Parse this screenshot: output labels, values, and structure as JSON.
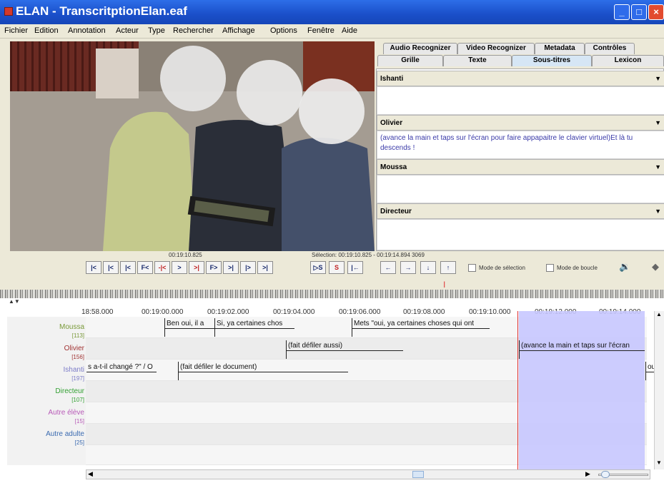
{
  "window": {
    "title": "ELAN - TranscritptionElan.eaf"
  },
  "menu": [
    "Fichier",
    "Edition",
    "Annotation",
    "Acteur",
    "Type",
    "Rechercher",
    "Affichage",
    "Options",
    "Fenêtre",
    "Aide"
  ],
  "tabs_row1": [
    "Audio Recognizer",
    "Video Recognizer",
    "Metadata",
    "Contrôles"
  ],
  "tabs_row2": [
    "Grille",
    "Texte",
    "Sous-titres",
    "Lexicon"
  ],
  "active_tab": "Sous-titres",
  "subtitles": [
    {
      "tier": "Ishanti",
      "text": ""
    },
    {
      "tier": "Olivier",
      "text": "(avance la main et taps sur l'écran pour faire appapaitre le clavier virtuel)Et là tu descends !"
    },
    {
      "tier": "Moussa",
      "text": ""
    },
    {
      "tier": "Directeur",
      "text": ""
    }
  ],
  "player": {
    "time": "00:19:10.825",
    "selection": "Sélection: 00:19:10.825 - 00:19:14.894  3069",
    "buttons": [
      "|<",
      "|<",
      "|<",
      "F<",
      "-|<",
      ">",
      ">|",
      "F>",
      ">|",
      "|>",
      ">|"
    ],
    "seg_buttons": [
      "▷S",
      "S",
      "|←"
    ],
    "nav_buttons": [
      "←",
      "→",
      "↓",
      "↑"
    ],
    "mode_selection": "Mode de sélection",
    "mode_loop": "Mode de boucle"
  },
  "ruler_ticks": [
    "18:58.000",
    "00:19:00.000",
    "00:19:02.000",
    "00:19:04.000",
    "00:19:06.000",
    "00:19:08.000",
    "00:19:10.000",
    "00:19:12.000",
    "00:19:14.000"
  ],
  "tiers": [
    {
      "name": "Moussa",
      "count": "[113]",
      "color": "#7a9a3a"
    },
    {
      "name": "Olivier",
      "count": "[156]",
      "color": "#a03232"
    },
    {
      "name": "Ishanti",
      "count": "[197]",
      "color": "#7c7cc8"
    },
    {
      "name": "Directeur",
      "count": "[107]",
      "color": "#32a032"
    },
    {
      "name": "Autre élève",
      "count": "[15]",
      "color": "#b85ab8"
    },
    {
      "name": "Autre adulte",
      "count": "[25]",
      "color": "#3a6ab0"
    }
  ],
  "annotations": {
    "moussa_1": "Ben oui, il a",
    "moussa_2": "Si, ya certaines chos",
    "moussa_3": "Mets \"oui, ya certaines choses qui ont",
    "olivier_1": "(fait défiler aussi)",
    "olivier_2": "(avance la main et taps sur l'écran",
    "ishanti_1": "s a-t-il changé ?\" / O",
    "ishanti_2": "(fait défiler le document)",
    "ishanti_3": "ou"
  },
  "colors": {
    "titlebar": "#1a4fc9",
    "selection": "#c8c8ff",
    "cursor": "#e03030"
  }
}
